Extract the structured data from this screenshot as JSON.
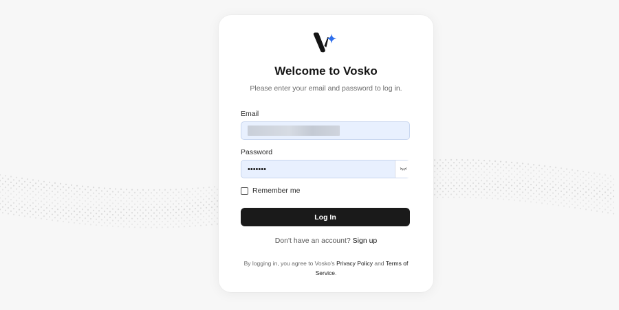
{
  "colors": {
    "background": "#f7f7f7",
    "card": "#ffffff",
    "input_fill": "#e8f0fe",
    "button": "#1a1a1a",
    "logo_dark": "#141414",
    "logo_accent": "#2f6fec"
  },
  "login": {
    "title": "Welcome to Vosko",
    "subtitle": "Please enter your email and password to log in.",
    "email_label": "Email",
    "email_value": "",
    "password_label": "Password",
    "password_value": "•••••••",
    "remember_label": "Remember me",
    "remember_checked": false,
    "login_button": "Log In",
    "signup_prompt": "Don't have an account?",
    "signup_link": "Sign up",
    "terms_prefix": "By logging in, you agree to Vosko's",
    "privacy_link": "Privacy Policy",
    "terms_and": "and",
    "terms_link": "Terms of Service",
    "terms_suffix": "."
  },
  "icons": {
    "logo": "vosko-logo-icon",
    "password_toggle": "eye-closed-icon",
    "checkbox": "checkbox-unchecked-icon"
  }
}
